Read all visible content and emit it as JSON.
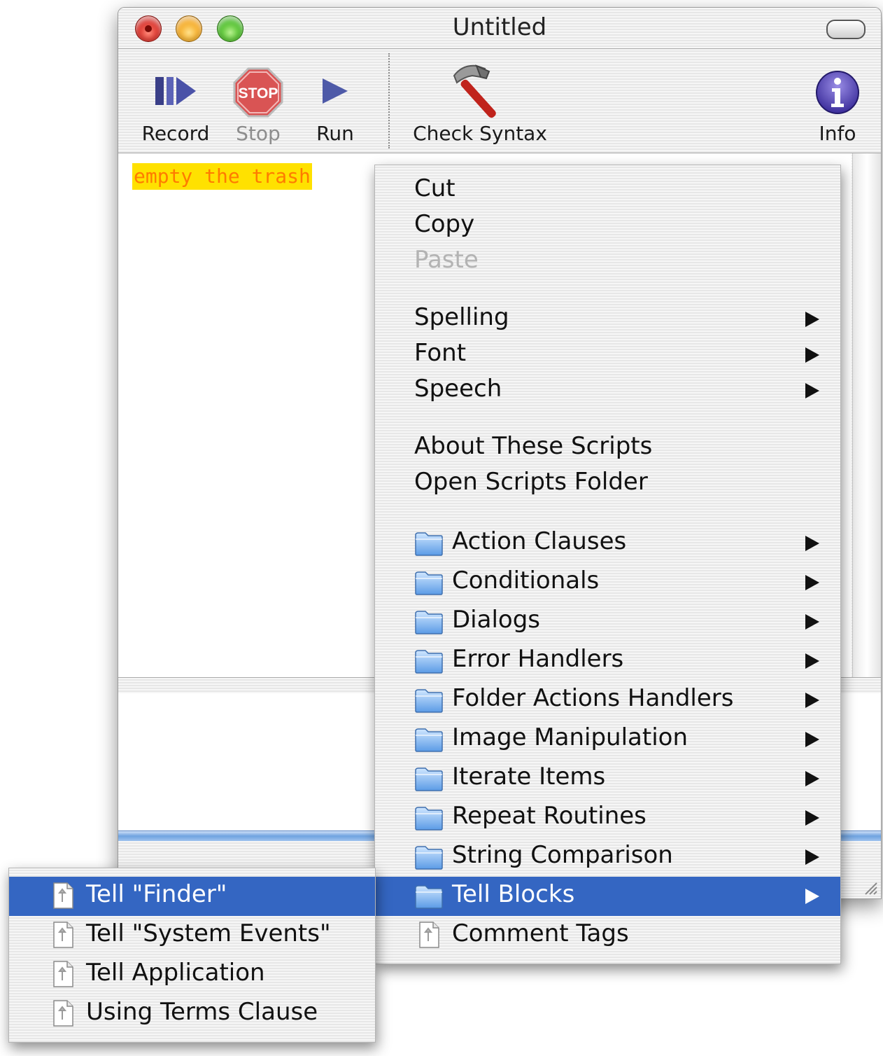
{
  "window": {
    "title": "Untitled"
  },
  "toolbar": {
    "record_label": "Record",
    "stop_label": "Stop",
    "stop_sign_text": "STOP",
    "run_label": "Run",
    "check_syntax_label": "Check Syntax",
    "info_label": "Info"
  },
  "editor": {
    "script_text": "empty the trash"
  },
  "context_menu": {
    "cut": "Cut",
    "copy": "Copy",
    "paste": "Paste",
    "spelling": "Spelling",
    "font": "Font",
    "speech": "Speech",
    "about_scripts": "About These Scripts",
    "open_scripts_folder": "Open Scripts Folder",
    "folders": [
      "Action Clauses",
      "Conditionals",
      "Dialogs",
      "Error Handlers",
      "Folder Actions Handlers",
      "Image Manipulation",
      "Iterate Items",
      "Repeat Routines",
      "String Comparison",
      "Tell Blocks"
    ],
    "comment_tags": "Comment Tags",
    "selected_item": "Tell Blocks"
  },
  "submenu": {
    "items": [
      "Tell \"Finder\"",
      "Tell \"System Events\"",
      "Tell Application",
      "Using Terms Clause"
    ],
    "selected_item": "Tell \"Finder\""
  },
  "colors": {
    "selection": "#3466c2",
    "script_highlight": "#ffe100",
    "script_text": "#ff7b00"
  },
  "icons": {
    "record": "record-icon",
    "stop": "stop-sign-icon",
    "run": "play-icon",
    "check_syntax": "hammer-icon",
    "info": "info-icon",
    "folder": "folder-icon",
    "script_file": "script-document-icon"
  }
}
